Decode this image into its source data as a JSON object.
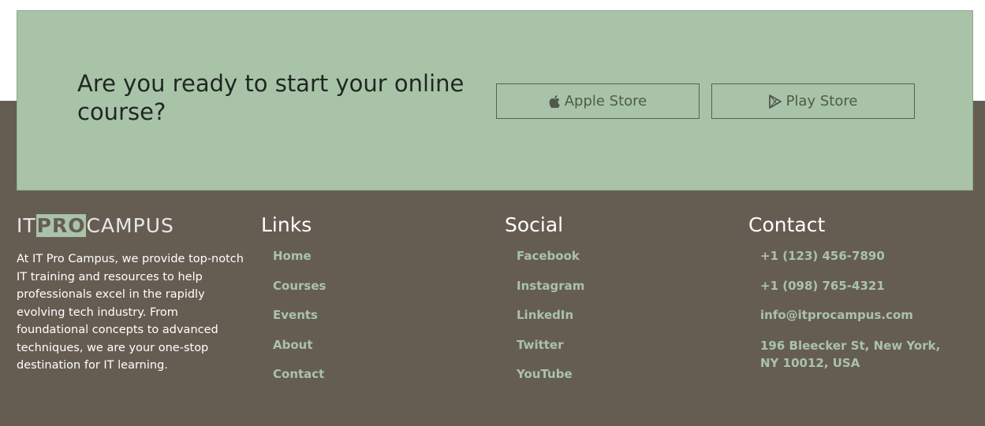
{
  "cta": {
    "title": "Are you ready to start your online course?",
    "apple_label": "Apple Store",
    "play_label": "Play Store"
  },
  "brand": {
    "logo_it": "IT",
    "logo_pro": "PRO",
    "logo_campus": "CAMPUS",
    "about": "At IT Pro Campus, we provide top-notch IT training and resources to help professionals excel in the rapidly evolving tech industry. From foundational concepts to advanced techniques, we are your one-stop destination for IT learning."
  },
  "links": {
    "heading": "Links",
    "items": [
      "Home",
      "Courses",
      "Events",
      "About",
      "Contact"
    ]
  },
  "social": {
    "heading": "Social",
    "items": [
      "Facebook",
      "Instagram",
      "LinkedIn",
      "Twitter",
      "YouTube"
    ]
  },
  "contact": {
    "heading": "Contact",
    "items": [
      "+1 (123) 456-7890",
      "+1 (098) 765-4321",
      "info@itprocampus.com",
      "196 Bleecker St, New York, NY 10012, USA"
    ]
  },
  "colors": {
    "footer_bg": "#665d52",
    "accent": "#a9c3a8",
    "cta_text": "#1f2722"
  },
  "icons": {
    "apple": "apple-icon",
    "play": "play-store-icon"
  }
}
